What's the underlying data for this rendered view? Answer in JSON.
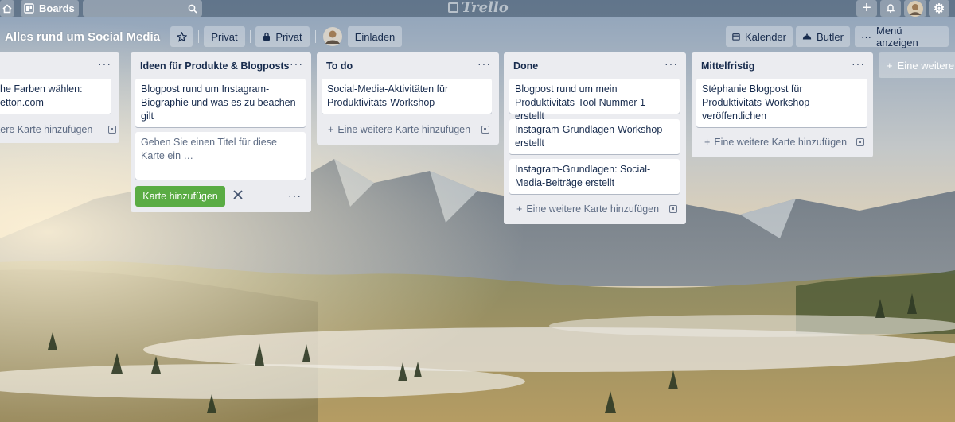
{
  "topbar": {
    "home_icon": "home-icon",
    "boards_label": "Boards",
    "search_value": "",
    "logo_text": "Trello",
    "plus_icon": "+",
    "bell_icon": "bell-icon",
    "gear_icon": "⚙"
  },
  "header": {
    "title": "Alles rund um Social Media",
    "visibility_label": "Privat",
    "team_label": "Privat",
    "invite_label": "Einladen",
    "calendar_label": "Kalender",
    "butler_label": "Butler",
    "menu_label": "Menü anzeigen"
  },
  "lists": [
    {
      "title": "",
      "cards": [
        "he Farben wählen: etton.com"
      ],
      "add_label": "itere Karte hinzufügen"
    },
    {
      "title": "Ideen für Produkte & Blogposts",
      "cards": [
        "Blogpost rund um Instagram-Biographie und was es zu beachen gilt"
      ],
      "composer_placeholder": "Geben Sie einen Titel für diese Karte ein …",
      "composer_button": "Karte hinzufügen"
    },
    {
      "title": "To do",
      "cards": [
        "Social-Media-Aktivitäten für Produktivitäts-Workshop"
      ],
      "add_label": "Eine weitere Karte hinzufügen"
    },
    {
      "title": "Done",
      "cards": [
        "Blogpost rund um mein Produktivitäts-Tool Nummer 1 erstellt",
        "Instagram-Grundlagen-Workshop erstellt",
        "Instagram-Grundlagen: Social-Media-Beiträge erstellt"
      ],
      "add_label": "Eine weitere Karte hinzufügen"
    },
    {
      "title": "Mittelfristig",
      "cards": [
        "Stéphanie Blogpost für Produktivitäts-Workshop veröffentlichen"
      ],
      "add_label": "Eine weitere Karte hinzufügen"
    }
  ],
  "add_list_label": "Eine weitere"
}
